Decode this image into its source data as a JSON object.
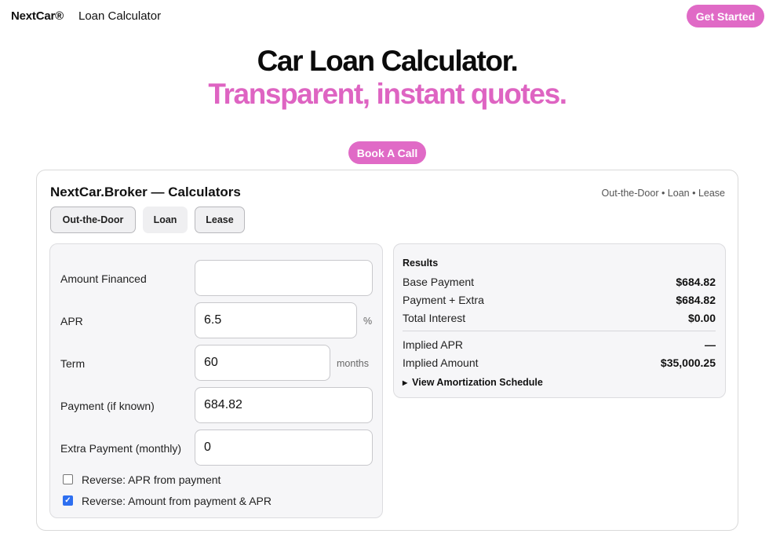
{
  "nav": {
    "brand": "NextCar®",
    "link": "Loan Calculator",
    "cta": "Get Started"
  },
  "hero": {
    "title": "Car Loan Calculator.",
    "subtitle": "Transparent, instant quotes.",
    "cta": "Book A Call"
  },
  "card": {
    "title": "NextCar.Broker — Calculators",
    "crumbs": "Out-the-Door • Loan • Lease",
    "tabs": [
      {
        "label": "Out-the-Door"
      },
      {
        "label": "Loan"
      },
      {
        "label": "Lease"
      }
    ],
    "active_tab": "Loan"
  },
  "form": {
    "fields": [
      {
        "label": "Amount Financed",
        "value": "",
        "unit": ""
      },
      {
        "label": "APR",
        "value": "6.5",
        "unit": "%"
      },
      {
        "label": "Term",
        "value": "60",
        "unit": "months"
      },
      {
        "label": "Payment (if known)",
        "value": "684.82",
        "unit": ""
      },
      {
        "label": "Extra Payment (monthly)",
        "value": "0",
        "unit": ""
      }
    ],
    "checkboxes": [
      {
        "label": "Reverse: APR from payment",
        "checked": false
      },
      {
        "label": "Reverse: Amount from payment & APR",
        "checked": true
      }
    ]
  },
  "results": {
    "title": "Results",
    "rows": [
      {
        "label": "Base Payment",
        "value": "$684.82"
      },
      {
        "label": "Payment + Extra",
        "value": "$684.82"
      },
      {
        "label": "Total Interest",
        "value": "$0.00"
      },
      {
        "label": "Implied APR",
        "value": "—"
      },
      {
        "label": "Implied Amount",
        "value": "$35,000.25"
      }
    ],
    "amortization": "View Amortization Schedule"
  },
  "colors": {
    "accent": "#e06ac6",
    "accent_text": "#de64c2",
    "checkbox": "#2e6ff0"
  }
}
